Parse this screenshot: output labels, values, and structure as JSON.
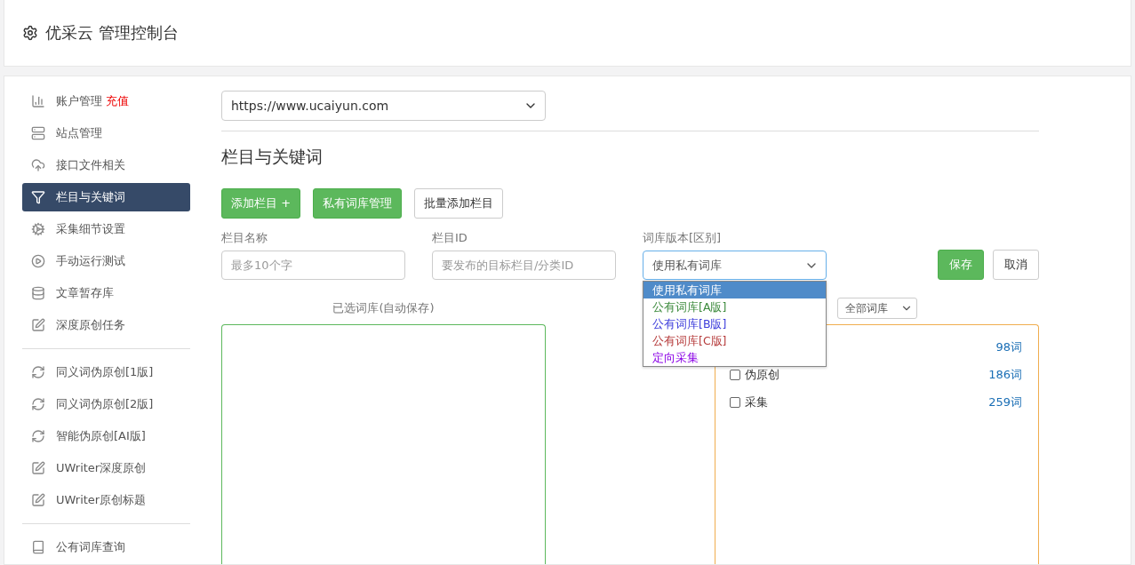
{
  "header": {
    "title": "优采云 管理控制台"
  },
  "sidebar": {
    "groups": [
      {
        "items": [
          {
            "label": "账户管理",
            "badge": "充值",
            "selected": false
          },
          {
            "label": "站点管理",
            "selected": false
          },
          {
            "label": "接口文件相关",
            "selected": false
          },
          {
            "label": "栏目与关键词",
            "selected": true
          },
          {
            "label": "采集细节设置",
            "selected": false
          },
          {
            "label": "手动运行测试",
            "selected": false
          },
          {
            "label": "文章暂存库",
            "selected": false
          },
          {
            "label": "深度原创任务",
            "selected": false
          }
        ]
      },
      {
        "items": [
          {
            "label": "同义词伪原创[1版]",
            "selected": false
          },
          {
            "label": "同义词伪原创[2版]",
            "selected": false
          },
          {
            "label": "智能伪原创[AI版]",
            "selected": false
          },
          {
            "label": "UWriter深度原创",
            "selected": false
          },
          {
            "label": "UWriter原创标题",
            "selected": false
          }
        ]
      },
      {
        "items": [
          {
            "label": "公有词库查询",
            "selected": false
          }
        ]
      }
    ]
  },
  "site_select": {
    "value": "https://www.ucaiyun.com"
  },
  "heading": "栏目与关键词",
  "buttons": [
    {
      "label": "添加栏目 +",
      "kind": "primary"
    },
    {
      "label": "私有词库管理",
      "kind": "primary"
    },
    {
      "label": "批量添加栏目",
      "kind": "default"
    }
  ],
  "form": {
    "fields": [
      {
        "label": "栏目名称",
        "placeholder": "最多10个字"
      },
      {
        "label": "栏目ID",
        "placeholder": "要发布的目标栏目/分类ID"
      }
    ],
    "version_label": "词库版本[区别]",
    "version_select": {
      "value": "使用私有词库",
      "expanded": true,
      "options": [
        {
          "label": "使用私有词库",
          "selected": true
        },
        {
          "label": "公有词库[A版]",
          "selected": false,
          "color": "#3c8a3c"
        },
        {
          "label": "公有词库[B版]",
          "selected": false,
          "color": "#3b3bdb"
        },
        {
          "label": "公有词库[C版]",
          "selected": false,
          "color": "#b53a3a"
        },
        {
          "label": "定向采集",
          "selected": false,
          "color": "#8a00e6"
        }
      ]
    },
    "save": "保存",
    "cancel": "取消"
  },
  "selected_panel": {
    "title": "已选词库(自动保存)"
  },
  "library_panel": {
    "filter": "全部词库",
    "rows": [
      {
        "count": "98词"
      },
      {
        "label": "伪原创",
        "count": "186词",
        "checked": false
      },
      {
        "label": "采集",
        "count": "259词",
        "checked": false
      }
    ]
  }
}
